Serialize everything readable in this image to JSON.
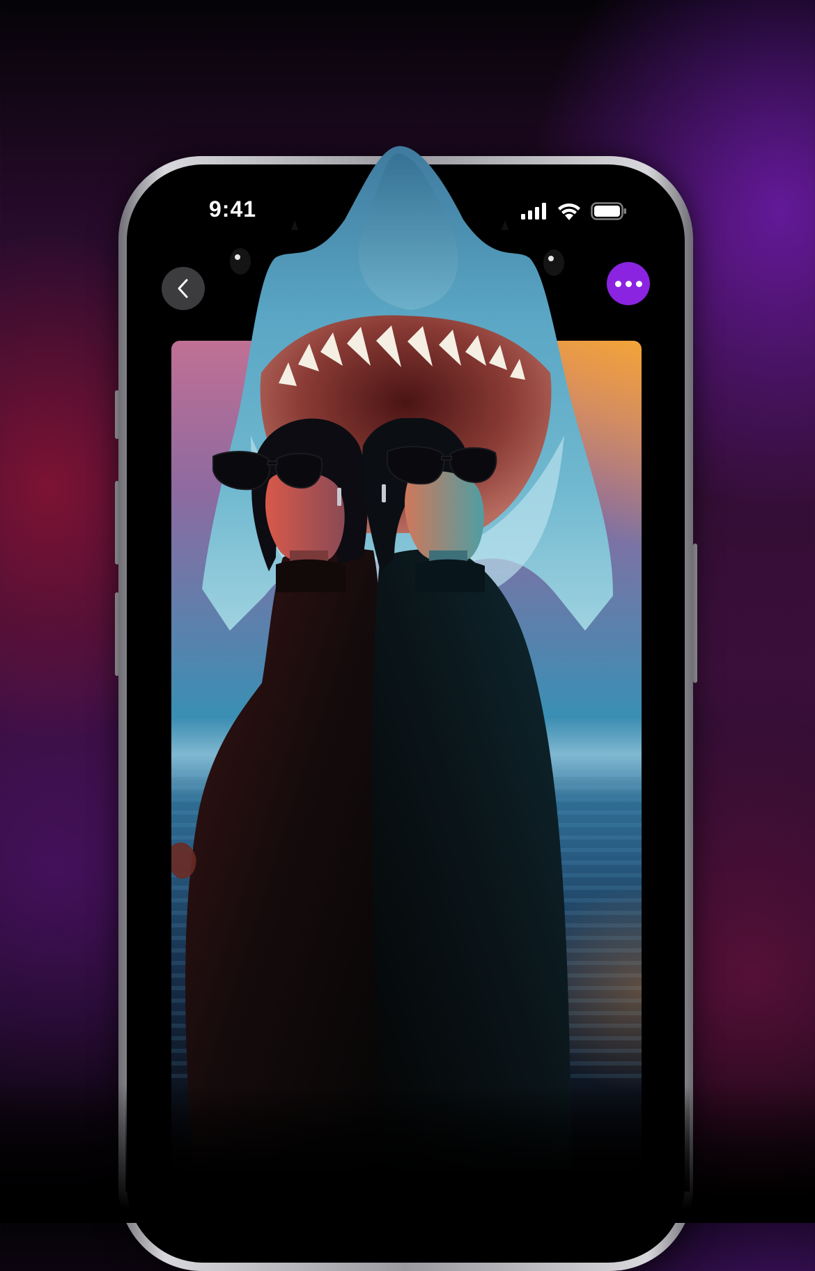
{
  "status_bar": {
    "time": "9:41",
    "icons": [
      "signal-icon",
      "wifi-icon",
      "battery-icon"
    ]
  },
  "navigation": {
    "back_icon": "chevron-left-icon",
    "more_icon": "more-dots-icon",
    "more_button_color": "#8A24E0"
  },
  "artwork": {
    "subject": "shark-and-twins-illustration"
  },
  "colors": {
    "accent": "#8A24E0",
    "background_magenta": "#5A1740",
    "background_purple": "#5B1C86"
  }
}
